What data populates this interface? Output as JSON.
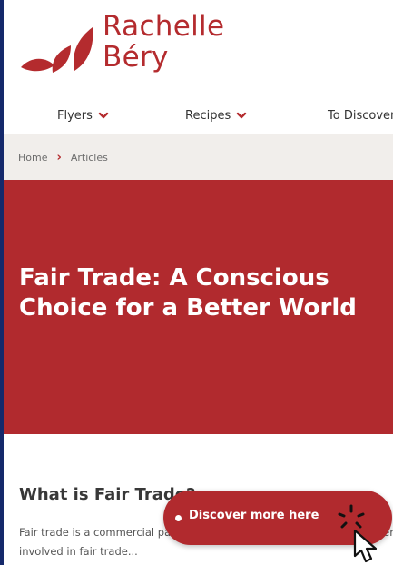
{
  "brand": {
    "name_line1": "Rachelle",
    "name_line2": "Béry",
    "color": "#b42b2e"
  },
  "nav": {
    "items": [
      {
        "label": "Flyers",
        "icon": "chevron-down-icon"
      },
      {
        "label": "Recipes",
        "icon": "chevron-down-icon"
      },
      {
        "label": "To Discover",
        "icon": "chevron-down-icon"
      }
    ]
  },
  "breadcrumb": {
    "items": [
      "Home",
      "Articles"
    ],
    "separator_icon": "chevron-right-icon"
  },
  "hero": {
    "title": "Fair Trade: A Conscious Choice for a Better World",
    "background": "#b12a2e"
  },
  "article": {
    "heading": "What is Fair Trade?",
    "body": "Fair trade is a commercial partnership that seeks greater equity in international trade. Organizations involved in fair trade..."
  },
  "cta": {
    "label": "Discover more here",
    "background": "#b12a2e"
  }
}
